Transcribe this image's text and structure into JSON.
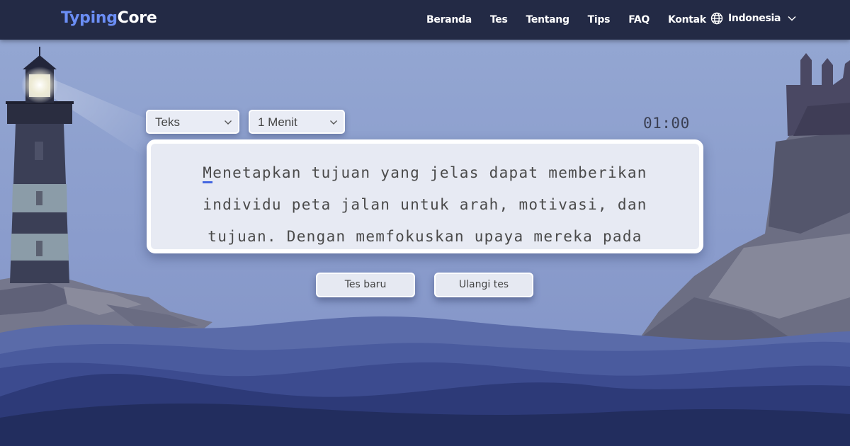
{
  "brand": {
    "part1": "Typing",
    "part2": "Core"
  },
  "nav": {
    "links": [
      "Beranda",
      "Tes",
      "Tentang",
      "Tips",
      "FAQ",
      "Kontak"
    ],
    "language": "Indonesia"
  },
  "controls": {
    "mode_select": "Teks",
    "duration_select": "1 Menit",
    "timer": "01:00"
  },
  "typing_text": {
    "cursor_char": "M",
    "lines": [
      "enetapkan tujuan yang jelas dapat memberikan",
      "individu peta jalan untuk arah, motivasi, dan",
      "tujuan. Dengan memfokuskan upaya mereka pada"
    ]
  },
  "buttons": {
    "new_test": "Tes baru",
    "retry_test": "Ulangi tes"
  },
  "colors": {
    "nav_bg": "#232a45",
    "brand_accent": "#6b8ef5",
    "sky": "#8d9dc9",
    "sea_dark": "#222d5e",
    "cursor_underline": "#4466e0"
  },
  "icons": {
    "language": "globe-icon",
    "dropdown": "chevron-down-icon"
  }
}
